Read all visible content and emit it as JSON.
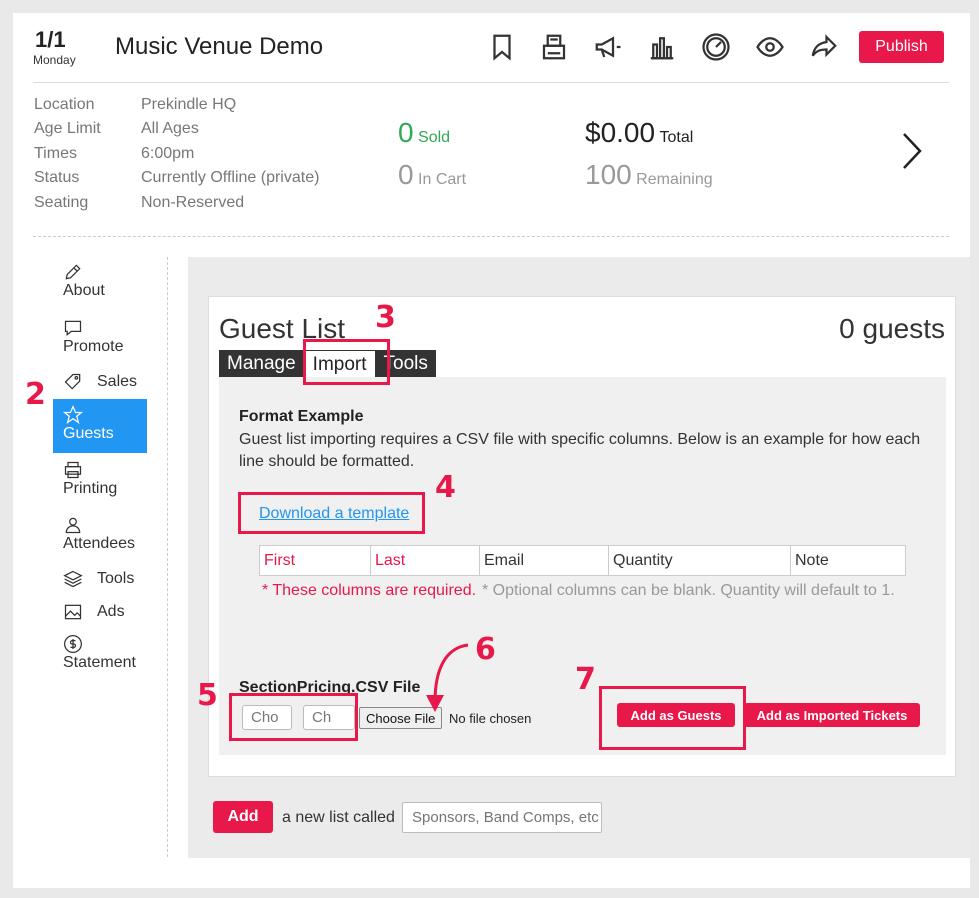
{
  "header": {
    "date_fraction": "1/1",
    "date_day": "Monday",
    "event_title": "Music Venue Demo",
    "publish_label": "Publish",
    "icons": [
      "bookmark-icon",
      "register-icon",
      "megaphone-icon",
      "bar-chart-icon",
      "speedometer-icon",
      "eye-icon",
      "share-icon"
    ]
  },
  "info": {
    "rows": [
      {
        "label": "Location",
        "value": "Prekindle HQ"
      },
      {
        "label": "Age Limit",
        "value": "All Ages"
      },
      {
        "label": "Times",
        "value": "6:00pm"
      },
      {
        "label": "Status",
        "value": "Currently Offline (private)"
      },
      {
        "label": "Seating",
        "value": "Non-Reserved"
      }
    ],
    "sold_count": "0",
    "sold_label": "Sold",
    "cart_count": "0",
    "cart_label": "In Cart",
    "total_amount": "$0.00",
    "total_label": "Total",
    "remaining_count": "100",
    "remaining_label": "Remaining"
  },
  "sidebar": {
    "items": [
      {
        "label": "About",
        "icon": "pencil-icon"
      },
      {
        "label": "Promote",
        "icon": "speech-bubble-icon"
      },
      {
        "label": "Sales",
        "icon": "tag-icon"
      },
      {
        "label": "Guests",
        "icon": "star-icon",
        "active": true
      },
      {
        "label": "Printing",
        "icon": "printer-icon"
      },
      {
        "label": "Attendees",
        "icon": "person-icon"
      },
      {
        "label": "Tools",
        "icon": "layers-icon"
      },
      {
        "label": "Ads",
        "icon": "image-icon"
      },
      {
        "label": "Statement",
        "icon": "dollar-icon"
      }
    ]
  },
  "guest_list": {
    "title": "Guest List",
    "count": "0 guests",
    "tabs": [
      "Manage",
      "Import",
      "Tools"
    ],
    "active_tab": "Import",
    "format_title": "Format Example",
    "format_desc": "Guest list importing requires a CSV file with specific columns. Below is an example for how each line should be formatted.",
    "download_link": "Download a template",
    "columns": [
      {
        "name": "First",
        "required": true
      },
      {
        "name": "Last",
        "required": true
      },
      {
        "name": "Email",
        "required": false
      },
      {
        "name": "Quantity",
        "required": false
      },
      {
        "name": "Note",
        "required": false
      }
    ],
    "required_note": "* These columns are required.",
    "optional_note": "* Optional columns can be blank. Quantity will default to 1.",
    "file_label": "SectionPricing.CSV File",
    "select1": "Cho",
    "select2": "Ch",
    "choose_file": "Choose File",
    "no_file": "No file chosen",
    "add_guests": "Add as Guests",
    "add_imported": "Add as Imported Tickets"
  },
  "new_list": {
    "add_label": "Add",
    "text": "a new list called",
    "placeholder": "Sponsors, Band Comps, etc"
  },
  "annotations": [
    "2",
    "3",
    "4",
    "5",
    "6",
    "7"
  ],
  "colors": {
    "accent": "#e8184a",
    "active_nav": "#2196f3",
    "sold_green": "#2eaa55",
    "annotation": "#e8184a"
  }
}
